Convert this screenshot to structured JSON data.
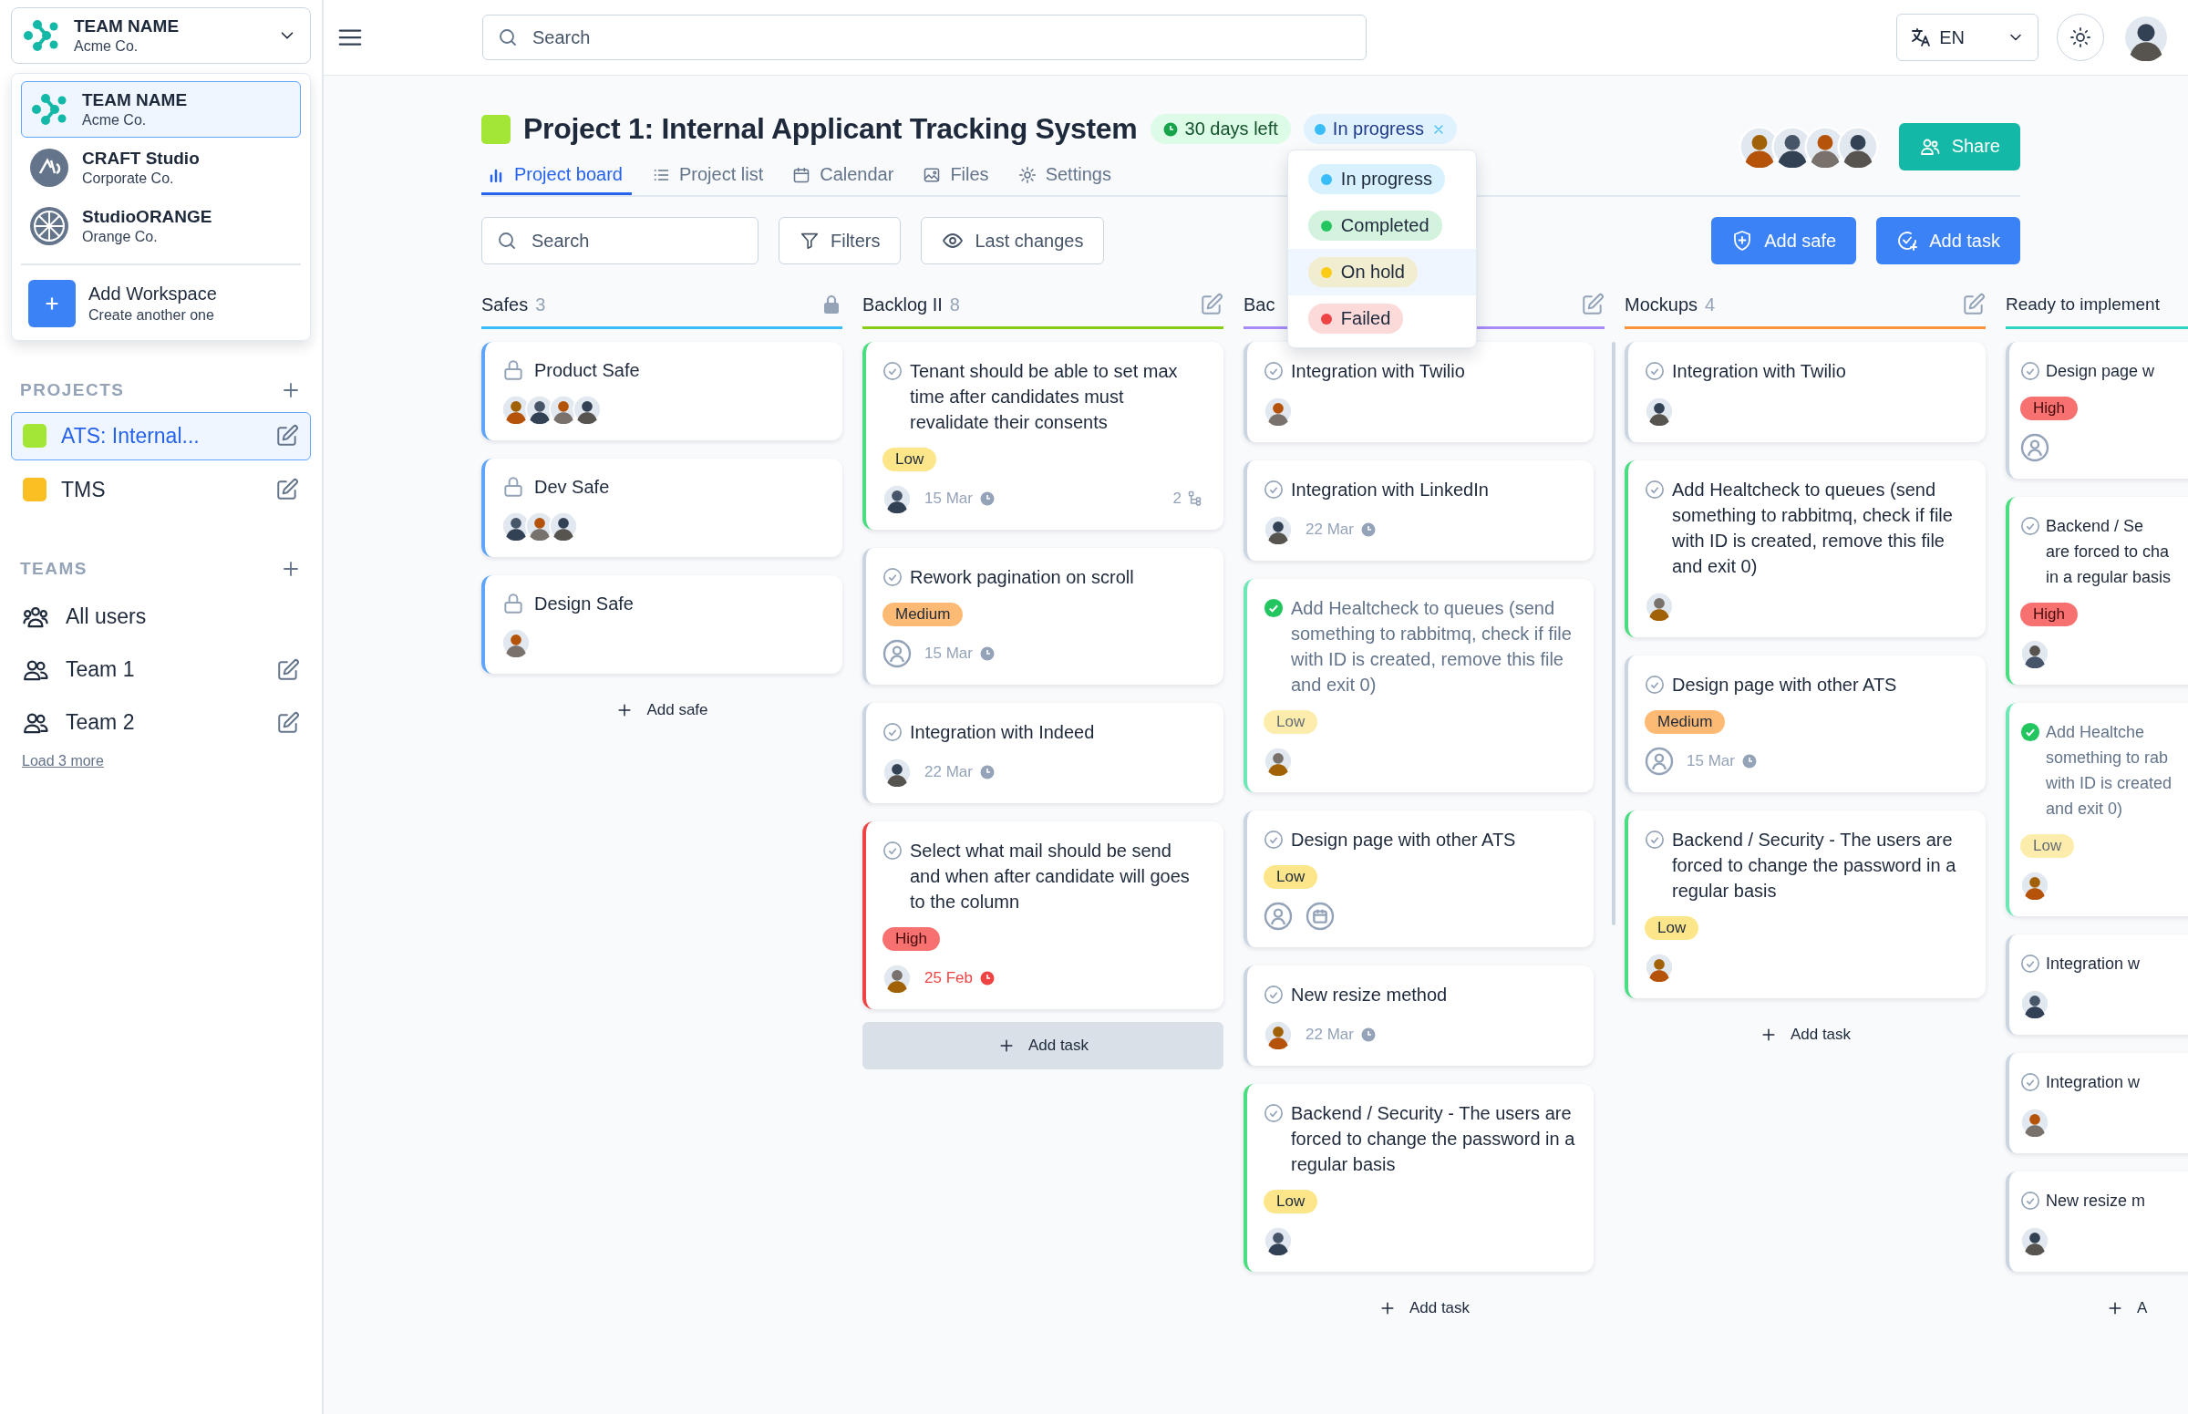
{
  "workspace_switcher": {
    "name": "TEAM NAME",
    "company": "Acme Co."
  },
  "workspace_menu": {
    "items": [
      {
        "name": "TEAM NAME",
        "company": "Acme Co.",
        "kind": "dots",
        "selected": true
      },
      {
        "name": "CRAFT Studio",
        "company": "Corporate Co.",
        "kind": "craft",
        "selected": false
      },
      {
        "name": "StudioORANGE",
        "company": "Orange Co.",
        "kind": "orange",
        "selected": false
      }
    ],
    "add": {
      "title": "Add Workspace",
      "subtitle": "Create another one"
    }
  },
  "projects": {
    "heading": "PROJECTS",
    "items": [
      {
        "name": "ATS: Internal...",
        "color": "#a3e635",
        "selected": true
      },
      {
        "name": "TMS",
        "color": "#fbbf24",
        "selected": false
      }
    ]
  },
  "teams": {
    "heading": "TEAMS",
    "items": [
      {
        "name": "All users",
        "kind": "all",
        "editable": false
      },
      {
        "name": "Team 1",
        "kind": "team",
        "editable": true
      },
      {
        "name": "Team 2",
        "kind": "team",
        "editable": true
      }
    ],
    "more": "Load 3 more"
  },
  "topbar": {
    "search": {
      "placeholder": "Search"
    },
    "language": "EN"
  },
  "project": {
    "title": "Project 1: Internal Applicant Tracking System",
    "deadline": "30 days left",
    "status": "In progress",
    "status_menu": [
      {
        "label": "In progress",
        "color": "#38bdf8",
        "hovered": false
      },
      {
        "label": "Completed",
        "color": "#22c55e",
        "hovered": false
      },
      {
        "label": "On hold",
        "color": "#facc15",
        "hovered": true
      },
      {
        "label": "Failed",
        "color": "#ef4444",
        "hovered": false
      }
    ]
  },
  "tabs": [
    {
      "label": "Project board",
      "selected": true
    },
    {
      "label": "Project list",
      "selected": false
    },
    {
      "label": "Calendar",
      "selected": false
    },
    {
      "label": "Files",
      "selected": false
    },
    {
      "label": "Settings",
      "selected": false
    }
  ],
  "members": [
    {
      "kind": "photo"
    },
    {
      "kind": "photo"
    },
    {
      "kind": "photo"
    },
    {
      "kind": "photo"
    }
  ],
  "share": "Share",
  "toolbar": {
    "search": {
      "placeholder": "Search"
    },
    "filters": "Filters",
    "last_changes": "Last changes",
    "add_safe": "Add safe",
    "add_task": "Add task"
  },
  "columns": [
    {
      "title": "Safes",
      "count": "3",
      "kind": "safes",
      "color": "#38bdf8",
      "locked": true,
      "editable": false,
      "add": "Add safe",
      "add_highlighted": false,
      "cards": [
        {
          "title": "Product Safe",
          "color": "#60a5fa",
          "avatars": [
            {
              "kind": "photo"
            },
            {
              "kind": "photo"
            },
            {
              "kind": "photo"
            },
            {
              "kind": "photo"
            }
          ]
        },
        {
          "title": "Dev Safe",
          "color": "#60a5fa",
          "avatars": [
            {
              "kind": "photo"
            },
            {
              "kind": "photo"
            },
            {
              "kind": "photo"
            }
          ]
        },
        {
          "title": "Design Safe",
          "color": "#60a5fa",
          "avatars": [
            {
              "kind": "photo"
            }
          ]
        }
      ]
    },
    {
      "title": "Backlog II",
      "count": "8",
      "kind": "tasks",
      "color": "#84cc16",
      "locked": false,
      "editable": true,
      "add": "Add task",
      "add_highlighted": true,
      "cards": [
        {
          "title": "Tenant should be able to set max time after candidates must revalidate their consents",
          "done": false,
          "color": "#4ade80",
          "tag": {
            "text": "Low",
            "kind": "low"
          },
          "assignee": {
            "kind": "photo"
          },
          "date": "15 Mar",
          "overdue": false,
          "subtasks": "2"
        },
        {
          "title": "Rework pagination on scroll",
          "done": false,
          "color": "#cbd5e1",
          "tag": {
            "text": "Medium",
            "kind": "medium"
          },
          "assignee": {
            "kind": "placeholder"
          },
          "date": "15 Mar",
          "overdue": false
        },
        {
          "title": "Integration with Indeed",
          "done": false,
          "color": "#cbd5e1",
          "assignee": {
            "kind": "photo"
          },
          "date": "22 Mar",
          "overdue": false
        },
        {
          "title": "Select what mail should be send and when after candidate will goes to the column",
          "done": false,
          "color": "#ef4444",
          "tag": {
            "text": "High",
            "kind": "high"
          },
          "assignee": {
            "kind": "photo"
          },
          "date": "25 Feb",
          "overdue": true
        }
      ]
    },
    {
      "title": "Bac",
      "kind": "tasks",
      "color": "#a78bfa",
      "locked": false,
      "editable": true,
      "add": "Add task",
      "add_highlighted": false,
      "scrollbar": true,
      "cards": [
        {
          "title": "Integration with Twilio",
          "done": false,
          "color": "#cbd5e1",
          "assignee": {
            "kind": "photo"
          }
        },
        {
          "title": "Integration with LinkedIn",
          "done": false,
          "color": "#cbd5e1",
          "assignee": {
            "kind": "photo"
          },
          "date": "22 Mar",
          "overdue": false
        },
        {
          "title": "Add Healtcheck to queues (send something to rabbitmq, check if file with ID is created, remove this file and exit 0)",
          "done": true,
          "color": "#6ee7b7",
          "tag": {
            "text": "Low",
            "kind": "low"
          },
          "assignee": {
            "kind": "photo"
          }
        },
        {
          "title": "Design page with other ATS",
          "done": false,
          "color": "#cbd5e1",
          "tag": {
            "text": "Low",
            "kind": "low"
          },
          "assignee": {
            "kind": "placeholder"
          },
          "date_placeholder": true
        },
        {
          "title": "New resize method",
          "done": false,
          "color": "#cbd5e1",
          "assignee": {
            "kind": "photo"
          },
          "date": "22 Mar",
          "overdue": false
        },
        {
          "title": "Backend / Security - The users are forced to change the password in a regular basis",
          "done": false,
          "color": "#4ade80",
          "tag": {
            "text": "Low",
            "kind": "low"
          },
          "assignee": {
            "kind": "photo"
          }
        }
      ]
    },
    {
      "title": "Mockups",
      "count": "4",
      "kind": "tasks",
      "color": "#fb923c",
      "locked": false,
      "editable": true,
      "add": "Add task",
      "add_highlighted": false,
      "cards": [
        {
          "title": "Integration with Twilio",
          "done": false,
          "color": "#cbd5e1",
          "assignee": {
            "kind": "photo"
          }
        },
        {
          "title": "Add Healtcheck to queues (send something to rabbitmq, check if file with ID is created, remove this file and exit 0)",
          "done": false,
          "color": "#4ade80",
          "assignee": {
            "kind": "photo"
          }
        },
        {
          "title": "Design page with other ATS",
          "done": false,
          "color": "#cbd5e1",
          "tag": {
            "text": "Medium",
            "kind": "medium"
          },
          "assignee": {
            "kind": "placeholder"
          },
          "date": "15 Mar",
          "overdue": false
        },
        {
          "title": "Backend / Security - The users are forced to change the password in a regular basis",
          "done": false,
          "color": "#4ade80",
          "tag": {
            "text": "Low",
            "kind": "low"
          },
          "assignee": {
            "kind": "photo"
          }
        }
      ]
    },
    {
      "title": "Ready to implement",
      "kind": "tasks",
      "color": "#2dd4bf",
      "locked": false,
      "editable": false,
      "add": "A",
      "add_highlighted": false,
      "cards": [
        {
          "title": "Design page w",
          "done": false,
          "color": "#cbd5e1",
          "tag": {
            "text": "High",
            "kind": "high"
          },
          "assignee": {
            "kind": "placeholder"
          }
        },
        {
          "title": "Backend / Se\nare forced to cha\nin a regular basis",
          "done": false,
          "color": "#4ade80",
          "tag": {
            "text": "High",
            "kind": "high"
          },
          "assignee": {
            "kind": "photo"
          }
        },
        {
          "title": "Add Healtche\nsomething to rab\nwith ID is created\nand exit 0)",
          "done": true,
          "color": "#6ee7b7",
          "tag": {
            "text": "Low",
            "kind": "low"
          },
          "assignee": {
            "kind": "photo"
          }
        },
        {
          "title": "Integration w",
          "done": false,
          "color": "#cbd5e1",
          "assignee": {
            "kind": "photo"
          }
        },
        {
          "title": "Integration w",
          "done": false,
          "color": "#cbd5e1",
          "assignee": {
            "kind": "photo"
          }
        },
        {
          "title": "New resize m",
          "done": false,
          "color": "#cbd5e1",
          "assignee": {
            "kind": "photo"
          }
        }
      ]
    }
  ]
}
